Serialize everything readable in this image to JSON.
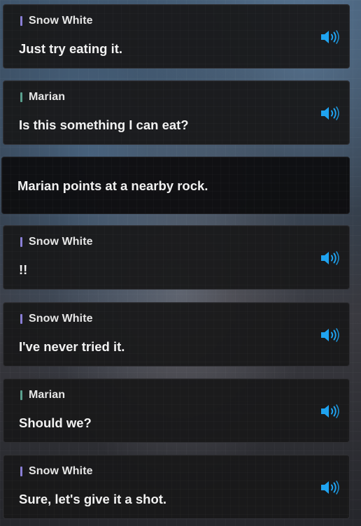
{
  "colors": {
    "snow_white_bar": "#8a7fd6",
    "marian_bar": "#5aa08e",
    "voice_icon": "#1fa3f0"
  },
  "dialogue": [
    {
      "speaker": "Snow White",
      "text": "Just try eating it.",
      "voice_icon": "speaker-volume-icon"
    },
    {
      "speaker": "Marian",
      "text": "Is this something I can eat?",
      "voice_icon": "speaker-volume-icon"
    },
    {
      "speaker": "",
      "text": "Marian points at a nearby rock.",
      "voice_icon": ""
    },
    {
      "speaker": "Snow White",
      "text": "!!",
      "voice_icon": "speaker-volume-icon"
    },
    {
      "speaker": "Snow White",
      "text": "I've never tried it.",
      "voice_icon": "speaker-volume-icon"
    },
    {
      "speaker": "Marian",
      "text": "Should we?",
      "voice_icon": "speaker-volume-icon"
    },
    {
      "speaker": "Snow White",
      "text": "Sure, let's give it a shot.",
      "voice_icon": "speaker-volume-icon"
    }
  ]
}
